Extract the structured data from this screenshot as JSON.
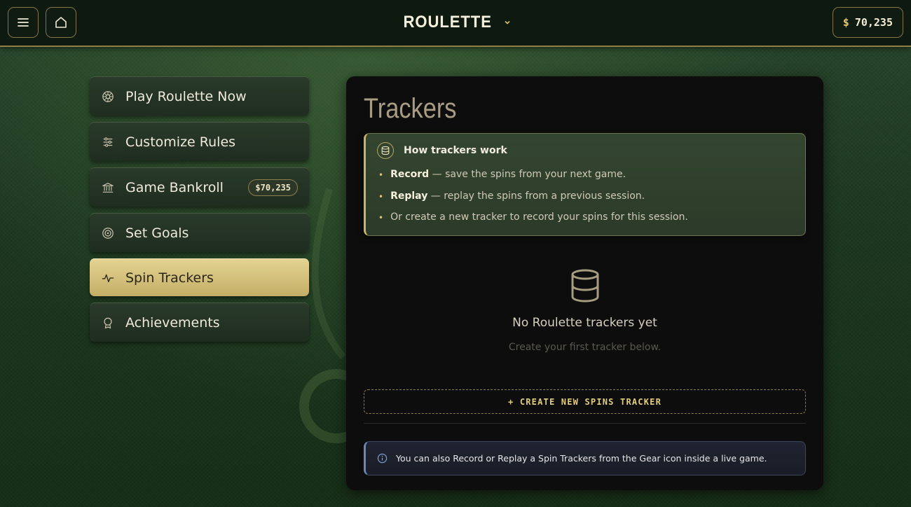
{
  "header": {
    "title": "ROULETTE",
    "balance_currency": "$",
    "balance_amount": "70,235",
    "menu_icon": "hamburger-icon",
    "home_icon": "home-icon"
  },
  "sidebar": {
    "items": [
      {
        "label": "Play Roulette Now",
        "icon": "roulette-wheel-icon",
        "active": false
      },
      {
        "label": "Customize Rules",
        "icon": "sliders-icon",
        "active": false
      },
      {
        "label": "Game Bankroll",
        "icon": "bank-icon",
        "active": false,
        "badge": "$70,235"
      },
      {
        "label": "Set Goals",
        "icon": "target-icon",
        "active": false
      },
      {
        "label": "Spin Trackers",
        "icon": "activity-icon",
        "active": true
      },
      {
        "label": "Achievements",
        "icon": "award-icon",
        "active": false
      }
    ]
  },
  "main": {
    "title": "Trackers",
    "how": {
      "title": "How trackers work",
      "items": [
        {
          "bold": "Record",
          "text": " — save the spins from your next game."
        },
        {
          "bold": "Replay",
          "text": " — replay the spins from a previous session."
        },
        {
          "bold": "",
          "text": "Or create a new tracker to record your spins for this session."
        }
      ]
    },
    "empty": {
      "title": "No Roulette trackers yet",
      "subtitle": "Create your first tracker below."
    },
    "create_button": "+ CREATE NEW SPINS TRACKER",
    "info": "You can also Record or Replay a Spin Trackers from the Gear icon inside a live game."
  },
  "colors": {
    "accent_gold": "#c9b367",
    "panel_bg": "#0d0d0d",
    "info_accent": "#6d86b8"
  }
}
